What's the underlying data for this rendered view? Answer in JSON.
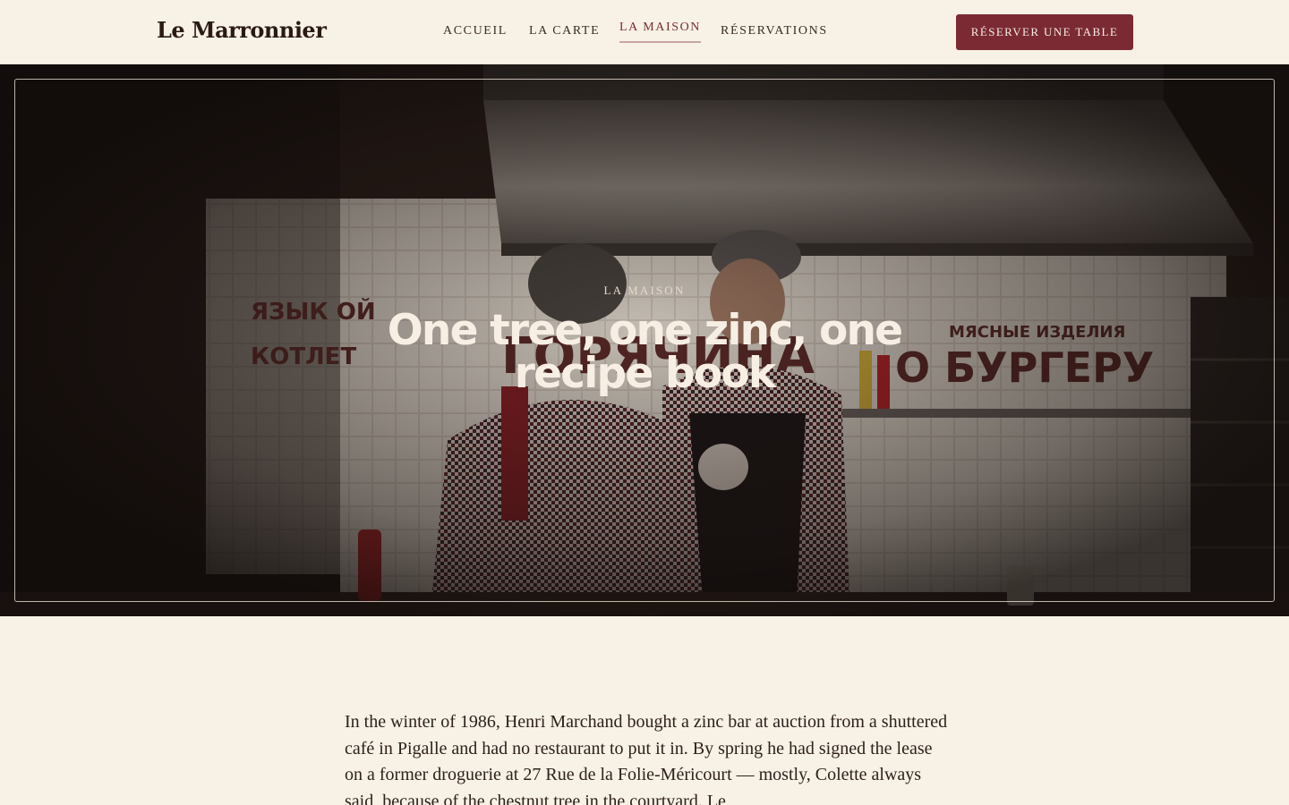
{
  "header": {
    "brand": "Le Marronnier",
    "nav": [
      {
        "label": "ACCUEIL",
        "active": false
      },
      {
        "label": "LA CARTE",
        "active": false
      },
      {
        "label": "LA MAISON",
        "active": true
      },
      {
        "label": "RÉSERVATIONS",
        "active": false
      }
    ],
    "cta_label": "RÉSERVER UNE TABLE"
  },
  "hero": {
    "eyebrow": "LA MAISON",
    "title": "One tree, one zinc, one recipe book"
  },
  "story": {
    "paragraph": "In the winter of 1986, Henri Marchand bought a zinc bar at auction from a shuttered café in Pigalle and had no restaurant to put it in. By spring he had signed the lease on a former droguerie at 27 Rue de la Folie-Méricourt — mostly, Colette always said, because of the chestnut tree in the courtyard. Le"
  },
  "colors": {
    "background": "#f8f1e6",
    "accent": "#7b2a34",
    "text": "#2a1c17"
  }
}
